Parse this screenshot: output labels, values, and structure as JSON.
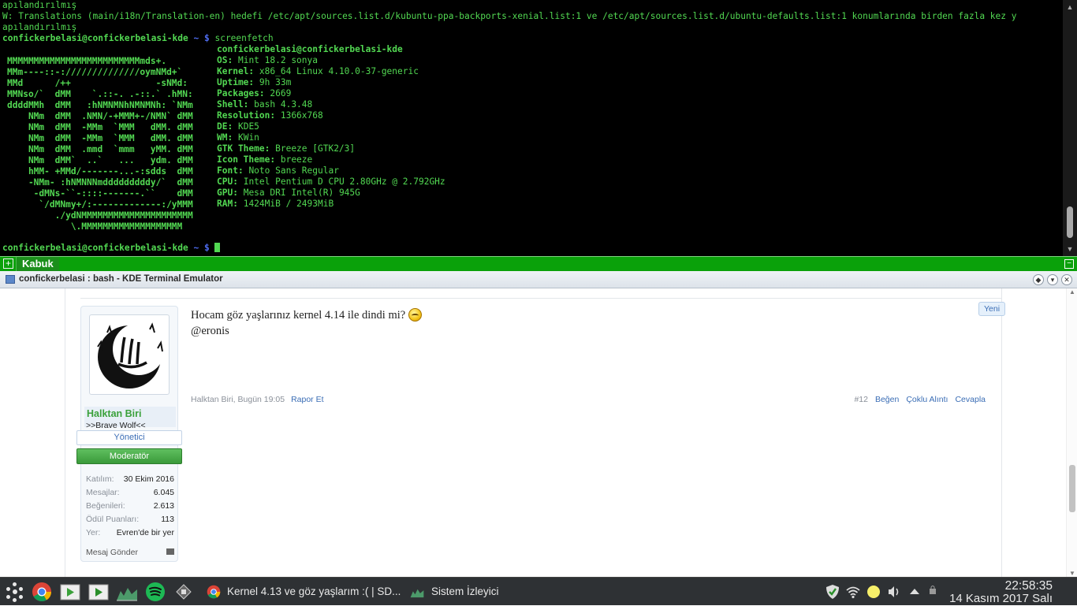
{
  "terminal": {
    "line1": "apılandırılmış",
    "line2": "W: Translations (main/i18n/Translation-en) hedefi /etc/apt/sources.list.d/kubuntu-ppa-backports-xenial.list:1 ve /etc/apt/sources.list.d/ubuntu-defaults.list:1 konumlarında birden fazla kez y",
    "line3": "apılandırılmış",
    "prompt_user": "confickerbelasi@confickerbelasi-kde",
    "prompt_path": "~ $",
    "command": "screenfetch",
    "header": "confickerbelasi@confickerbelasi-kde",
    "art": [
      "MMMMMMMMMMMMMMMMMMMMMMMMMmds+.",
      "MMm----::-://////////////oymNMd+`",
      "MMd      /++                -sNMd:",
      "MMNso/`  dMM    `.::-. .-::.` .hMN:",
      "ddddMMh  dMM   :hNMNMNhNMNMNh: `NMm",
      "    NMm  dMM  .NMN/-+MMM+-/NMN` dMM",
      "    NMm  dMM  -MMm  `MMM   dMM. dMM",
      "    NMm  dMM  -MMm  `MMM   dMM. dMM",
      "    NMm  dMM  .mmd  `mmm   yMM. dMM",
      "    NMm  dMM`  ..`   ...   ydm. dMM",
      "    hMM- +MMd/-------...-:sdds  dMM",
      "    -NMm- :hNMNNNmdddddddddy/`  dMM",
      "     -dMNs-``-::::-------.``    dMM",
      "      `/dMNmy+/:-------------:/yMMM",
      "         ./ydNMMMMMMMMMMMMMMMMMMMMM",
      "            \\.MMMMMMMMMMMMMMMMMMM"
    ],
    "info": [
      {
        "k": "OS:",
        "v": "Mint 18.2 sonya"
      },
      {
        "k": "Kernel:",
        "v": "x86_64 Linux 4.10.0-37-generic"
      },
      {
        "k": "Uptime:",
        "v": "9h 33m"
      },
      {
        "k": "Packages:",
        "v": "2669"
      },
      {
        "k": "Shell:",
        "v": "bash 4.3.48"
      },
      {
        "k": "Resolution:",
        "v": "1366x768"
      },
      {
        "k": "DE:",
        "v": "KDE5"
      },
      {
        "k": "WM:",
        "v": "KWin"
      },
      {
        "k": "GTK Theme:",
        "v": "Breeze [GTK2/3]"
      },
      {
        "k": "Icon Theme:",
        "v": "breeze"
      },
      {
        "k": "Font:",
        "v": "Noto Sans Regular"
      },
      {
        "k": "CPU:",
        "v": "Intel Pentium D CPU 2.80GHz @ 2.792GHz"
      },
      {
        "k": "GPU:",
        "v": "Mesa DRI Intel(R) 945G"
      },
      {
        "k": "RAM:",
        "v": "1424MiB / 2493MiB"
      }
    ],
    "tab_label": "Kabuk"
  },
  "window": {
    "title": "confickerbelasi : bash - KDE Terminal Emulator"
  },
  "post": {
    "username": "Halktan Biri",
    "user_title": ">>Brave Wolf<<",
    "role1": "Yönetici",
    "role2": "Moderatör",
    "stats": [
      {
        "label": "Katılım:",
        "value": "30 Ekim 2016"
      },
      {
        "label": "Mesajlar:",
        "value": "6.045"
      },
      {
        "label": "Beğenileri:",
        "value": "2.613"
      },
      {
        "label": "Ödül Puanları:",
        "value": "113"
      },
      {
        "label": "Yer:",
        "value": "Evren'de bir yer"
      }
    ],
    "send_message": "Mesaj Gönder",
    "message_line1": "Hocam göz yaşlarınız kernel 4.14 ile dindi mi?",
    "message_line2": "@eronis",
    "new_badge": "Yeni",
    "meta": "Halktan Biri, Bugün 19:05",
    "report": "Rapor Et",
    "post_number": "#12",
    "like": "Beğen",
    "multi_quote": "Çoklu Alıntı",
    "reply": "Cevapla"
  },
  "taskbar": {
    "task1": "Kernel 4.13 ve göz yaşlarım :( | SD...",
    "task2": "Sistem İzleyici",
    "time": "22:58:35",
    "date": "14 Kasım 2017 Salı"
  }
}
